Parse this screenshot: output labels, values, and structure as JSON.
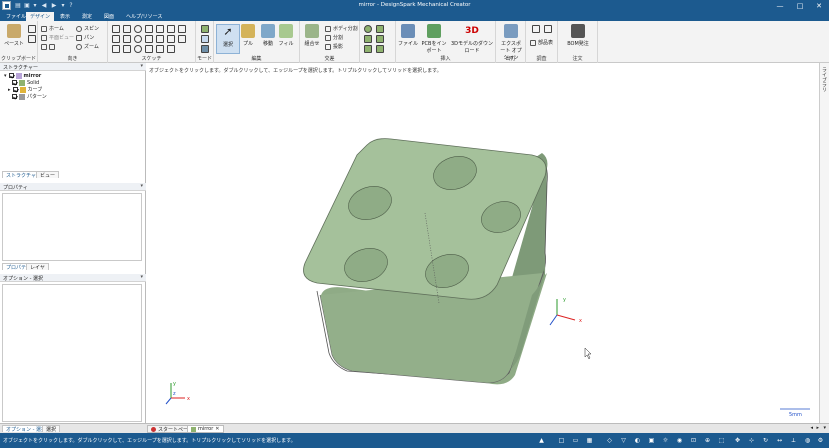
{
  "titlebar": {
    "title": "mirror - DesignSpark Mechanical Creator",
    "quick_access": [
      "▾",
      "◀",
      "▶",
      "▾",
      "?"
    ]
  },
  "ribbon_tabs": [
    "ファイル",
    "デザイン",
    "表示",
    "測定",
    "図面",
    "ヘルプ/リソース"
  ],
  "active_tab": "デザイン",
  "ribbon": {
    "clipboard": {
      "paste": "ペースト",
      "label": "クリップボード"
    },
    "orient": {
      "home": "ホーム",
      "plan": "平面ビュー",
      "spin": "スピン",
      "pan": "パン",
      "zoom": "ズーム",
      "label": "向き"
    },
    "sketch": {
      "label": "スケッチ"
    },
    "mode": {
      "label": "モード"
    },
    "edit": {
      "select": "選択",
      "pull": "プル",
      "move": "移動",
      "fill": "フィル",
      "label": "編集"
    },
    "intersect": {
      "combine": "組合せ",
      "split_body": "ボディ分割",
      "split": "分割",
      "project": "投影",
      "label": "交差"
    },
    "insert": {
      "file": "ファイル",
      "pcb": "PCBをインポート",
      "model3d": "3Dモデルのダウンロード",
      "label": "挿入"
    },
    "output": {
      "export": "エクスポート オプション",
      "label": "出力"
    },
    "investigate": {
      "parts": "部品表",
      "label": "調査"
    },
    "order": {
      "bom": "BOM発注",
      "label": "注文"
    }
  },
  "structure_panel": {
    "title": "ストラクチャー",
    "root": "mirror",
    "items": [
      "Solid",
      "カーブ",
      "パターン"
    ]
  },
  "panel_tabs_top": [
    "ストラクチャー",
    "ビュー"
  ],
  "properties_title": "プロパティ",
  "panel_tabs_mid": [
    "プロパティ",
    "レイヤ"
  ],
  "options_title": "オプション - 選択",
  "panel_tabs_bottom": [
    "オプション - 選択",
    "選択"
  ],
  "viewport": {
    "hint": "オブジェクトをクリックします。ダブルクリックして、エッジループを選択します。トリプルクリックしてソリッドを選択します。",
    "scale_label": "5mm",
    "axis": {
      "x": "x",
      "y": "y",
      "z": "z"
    }
  },
  "sidebar_label": "ライブラリ",
  "doc_tabs": [
    "スタートページ",
    "mirror"
  ],
  "status": {
    "text": "オブジェクトをクリックします。ダブルクリックして、エッジループを選択します。トリプルクリックしてソリッドを選択します。"
  },
  "colors": {
    "accent": "#1c5a8f",
    "solid": "#9dbb95"
  }
}
